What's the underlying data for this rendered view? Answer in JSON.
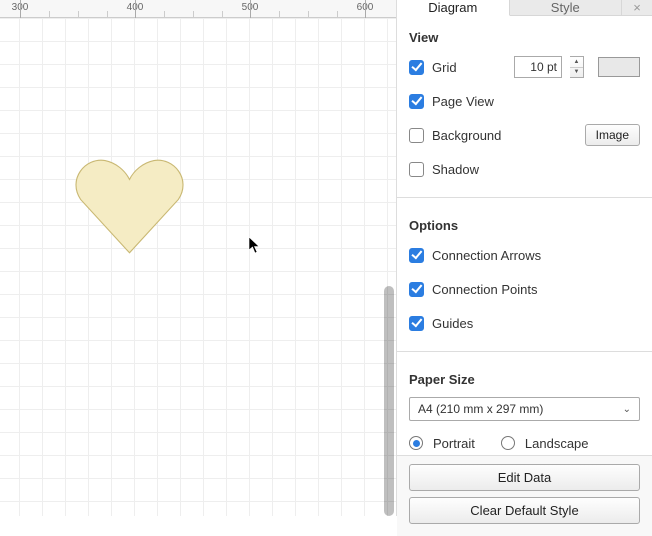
{
  "ruler": {
    "ticks": [
      300,
      400,
      500,
      600
    ]
  },
  "canvas": {
    "shape": {
      "type": "heart",
      "fill": "#f5ecc4",
      "stroke": "#c9b873"
    }
  },
  "tabs": {
    "diagram": "Diagram",
    "style": "Style",
    "active": "diagram",
    "close": "×"
  },
  "view": {
    "title": "View",
    "grid": {
      "label": "Grid",
      "checked": true,
      "value": "10 pt"
    },
    "pageView": {
      "label": "Page View",
      "checked": true
    },
    "background": {
      "label": "Background",
      "checked": false,
      "button": "Image"
    },
    "shadow": {
      "label": "Shadow",
      "checked": false
    }
  },
  "options": {
    "title": "Options",
    "connectionArrows": {
      "label": "Connection Arrows",
      "checked": true
    },
    "connectionPoints": {
      "label": "Connection Points",
      "checked": true
    },
    "guides": {
      "label": "Guides",
      "checked": true
    }
  },
  "paperSize": {
    "title": "Paper Size",
    "selected": "A4 (210 mm x 297 mm)",
    "orientation": {
      "portrait": {
        "label": "Portrait",
        "checked": true
      },
      "landscape": {
        "label": "Landscape",
        "checked": false
      }
    }
  },
  "buttons": {
    "editData": "Edit Data",
    "clearDefaultStyle": "Clear Default Style"
  }
}
